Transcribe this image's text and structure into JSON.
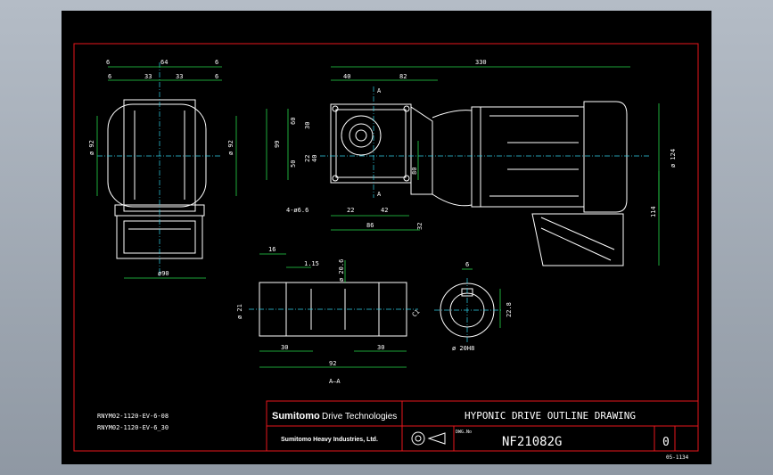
{
  "drawing": {
    "title": "HYPONIC DRIVE OUTLINE DRAWING",
    "drawing_number": "NF21082G",
    "revision": "0",
    "sheet_code": "05-1134",
    "company_brand": "Sumitomo",
    "company_sub": "Drive Technologies",
    "company_parent": "Sumitomo Heavy Industries, Ltd.",
    "dwg_no_label": "DWG.No",
    "section_label": "A–A",
    "section_marker": "A",
    "model_codes": [
      "RNYM02-1120-EV-6-08",
      "RNYM02-1120-EV-6_30"
    ]
  },
  "dims": {
    "side_top": [
      "6",
      "64",
      "6"
    ],
    "side_second": [
      "6",
      "33",
      "33",
      "6"
    ],
    "side_left_dia": "ø 92",
    "side_right_dia": "ø 92",
    "side_bottom": "ø90",
    "overall": "330",
    "front_40": "40",
    "front_82": "82",
    "left_60": "60",
    "left_99": "99",
    "left_30": "30",
    "left_22": "22",
    "left_50": "50",
    "left_40": "40",
    "right_80": "80",
    "motor_dia": "ø 124",
    "height_114": "114",
    "holes": "4-ø6.6",
    "bottom_22": "22",
    "bottom_42": "42",
    "bottom_86": "86",
    "bottom_32": "32",
    "shaft_16": "16",
    "shaft_115": "1.15",
    "shaft_dia20": "ø 20.6",
    "shaft_dia21": "ø 21",
    "shaft_chamfer": "C1",
    "shaft_30a": "30",
    "shaft_30b": "30",
    "shaft_92": "92",
    "key_6": "6",
    "key_228": "22.8",
    "key_bore": "ø 20H8"
  }
}
